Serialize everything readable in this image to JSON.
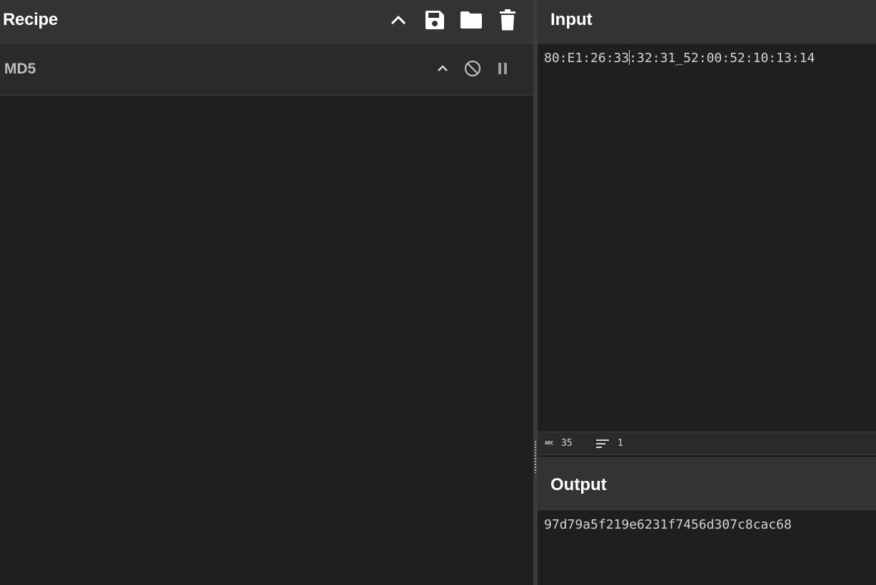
{
  "recipe": {
    "title": "Recipe",
    "icons": [
      "chevron-up-icon",
      "save-icon",
      "folder-icon",
      "trash-icon"
    ]
  },
  "operation": {
    "name": "MD5",
    "icons": [
      "chevron-up-icon",
      "disable-icon",
      "pause-icon"
    ]
  },
  "input": {
    "title": "Input",
    "text_before_caret": "80:E1:26:33",
    "text_after_caret": ":32:31_52:00:52:10:13:14"
  },
  "status": {
    "length_icon": "abc-icon",
    "length": "35",
    "lines_icon": "lines-icon",
    "lines": "1"
  },
  "output": {
    "title": "Output",
    "text": "97d79a5f219e6231f7456d307c8cac68"
  },
  "colors": {
    "header_bg": "#333333",
    "pane_bg": "#1f1f1f",
    "operation_bg": "#2a2a2a",
    "operation_text": "#bdbdbd",
    "text": "#d4d4d4"
  }
}
